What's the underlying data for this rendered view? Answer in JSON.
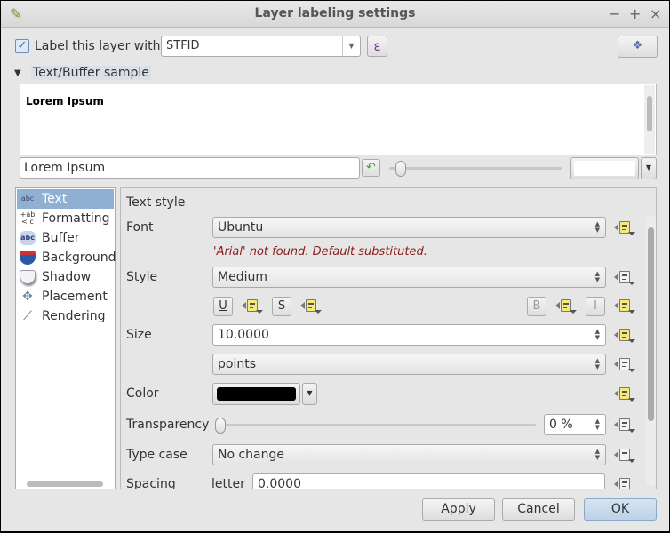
{
  "window": {
    "title": "Layer labeling settings",
    "minimize": "−",
    "maximize": "+",
    "close": "×"
  },
  "top": {
    "label_checkbox": "Label this layer with",
    "label_checked": true,
    "field_value": "STFID",
    "expression_button": "ε"
  },
  "sample": {
    "header": "Text/Buffer sample",
    "preview_text": "Lorem Ipsum",
    "input_value": "Lorem Ipsum"
  },
  "sidebar": {
    "items": [
      {
        "label": "Text",
        "icon": "abc",
        "selected": true
      },
      {
        "label": "Formatting",
        "icon": "+ab<c"
      },
      {
        "label": "Buffer",
        "icon": "abc"
      },
      {
        "label": "Background",
        "icon": "background-shield"
      },
      {
        "label": "Shadow",
        "icon": "shadow-shield"
      },
      {
        "label": "Placement",
        "icon": "placement-diamonds"
      },
      {
        "label": "Rendering",
        "icon": "brush"
      }
    ]
  },
  "text_style": {
    "section": "Text style",
    "font_label": "Font",
    "font_value": "Ubuntu",
    "font_error": "'Arial' not found. Default substituted.",
    "style_label": "Style",
    "style_value": "Medium",
    "underline": "U",
    "strikeout": "S",
    "bold": "B",
    "italic": "I",
    "size_label": "Size",
    "size_value": "10.0000",
    "size_unit": "points",
    "color_label": "Color",
    "color_value": "#000000",
    "transparency_label": "Transparency",
    "transparency_value": "0 %",
    "transparency_percent": 0,
    "typecase_label": "Type case",
    "typecase_value": "No change",
    "spacing_label": "Spacing",
    "letter_label": "letter",
    "letter_value": "0.0000"
  },
  "colors": {
    "error": "#8b1a1a",
    "selected": "#8fb0d3",
    "defined": "#f4e97a"
  },
  "buttons": {
    "apply": "Apply",
    "cancel": "Cancel",
    "ok": "OK"
  }
}
